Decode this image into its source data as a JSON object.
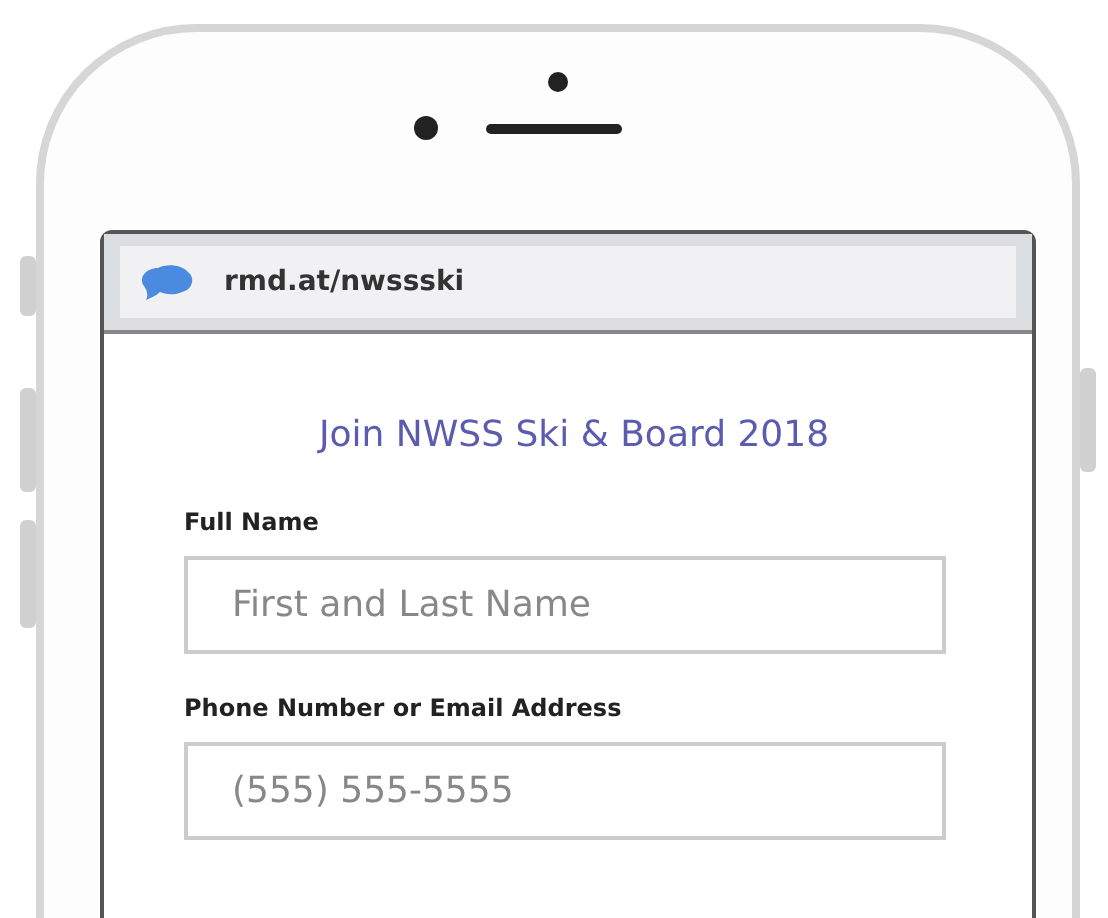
{
  "browser": {
    "url": "rmd.at/nwssski"
  },
  "form": {
    "title": "Join NWSS Ski & Board 2018",
    "fields": [
      {
        "label": "Full Name",
        "placeholder": "First and Last Name"
      },
      {
        "label": "Phone Number or Email Address",
        "placeholder": "(555) 555-5555"
      }
    ]
  }
}
